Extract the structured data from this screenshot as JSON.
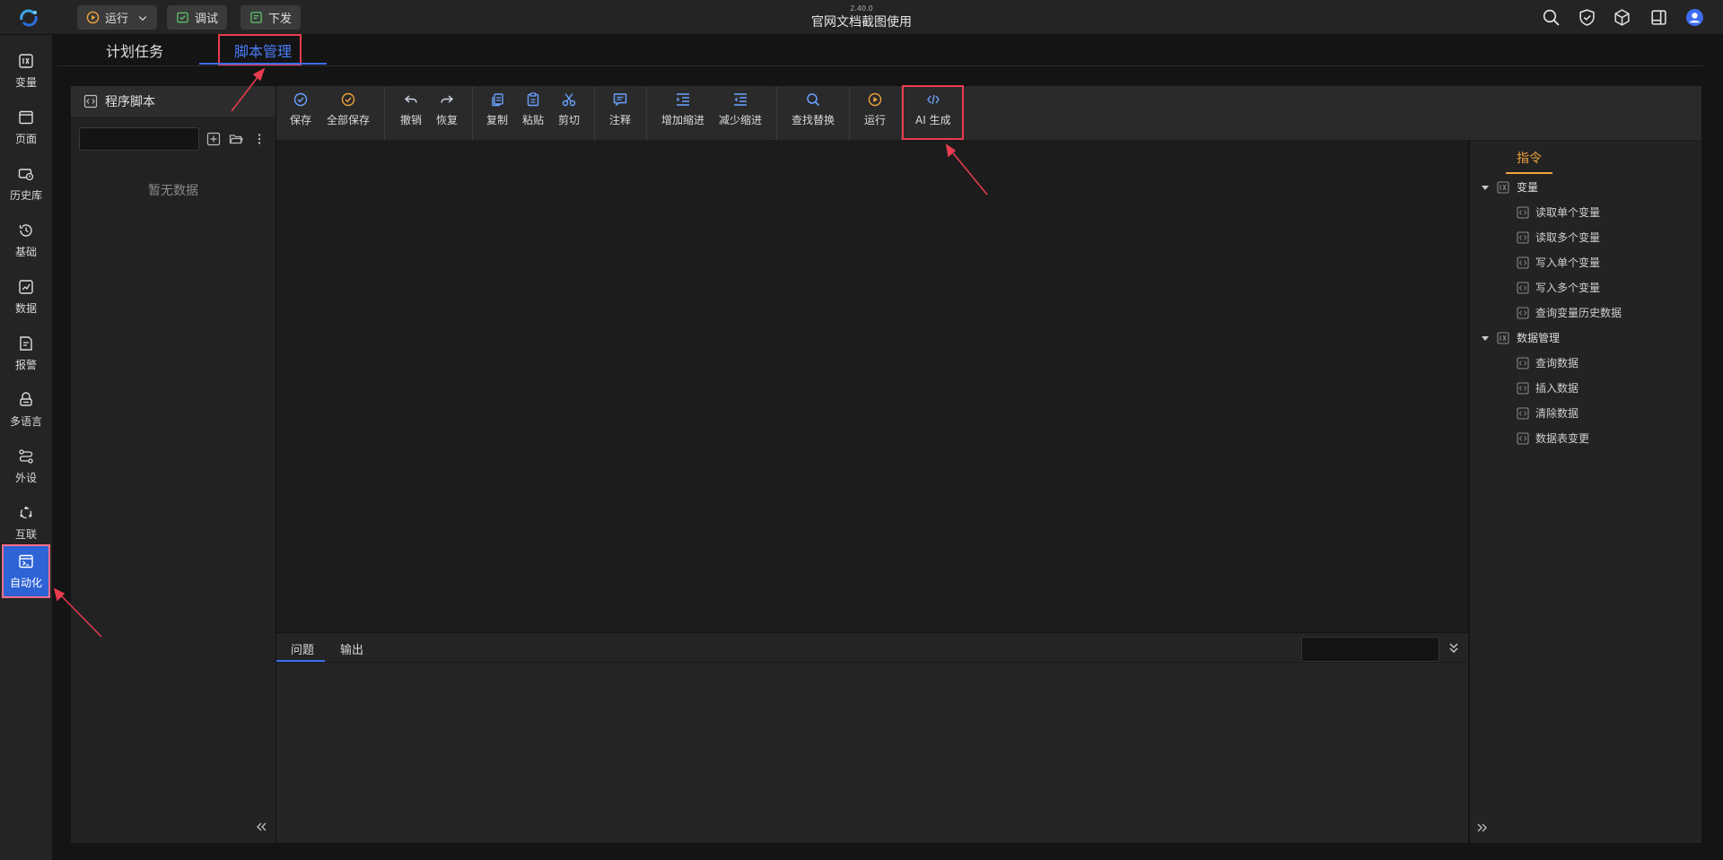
{
  "topbar": {
    "version": "2.40.0",
    "title": "官网文档截图使用",
    "run_label": "运行",
    "debug_label": "调试",
    "deploy_label": "下发",
    "icons": [
      "search-icon",
      "shield-check-icon",
      "package-icon",
      "layout-icon",
      "user-avatar-icon"
    ]
  },
  "sidebar": {
    "items": [
      {
        "label": "变量",
        "icon": "variable-icon"
      },
      {
        "label": "页面",
        "icon": "page-icon"
      },
      {
        "label": "历史库",
        "icon": "history-db-icon"
      },
      {
        "label": "基础",
        "icon": "clock-icon"
      },
      {
        "label": "数据",
        "icon": "data-chart-icon"
      },
      {
        "label": "报警",
        "icon": "alarm-doc-icon"
      },
      {
        "label": "多语言",
        "icon": "language-icon"
      },
      {
        "label": "外设",
        "icon": "peripheral-icon"
      },
      {
        "label": "互联",
        "icon": "interconnect-icon"
      },
      {
        "label": "自动化",
        "icon": "automation-icon",
        "active": true
      }
    ]
  },
  "tabs": {
    "plan": "计划任务",
    "script": "脚本管理"
  },
  "left_panel": {
    "header": "程序脚本",
    "search_value": "",
    "empty_text": "暂无数据"
  },
  "toolbar": {
    "save": "保存",
    "save_all": "全部保存",
    "undo": "撤销",
    "redo": "恢复",
    "copy": "复制",
    "paste": "粘贴",
    "cut": "剪切",
    "comment": "注释",
    "indent": "增加缩进",
    "outdent": "减少缩进",
    "find_replace": "查找替换",
    "run": "运行",
    "ai": "AI 生成"
  },
  "bottom": {
    "problems": "问题",
    "output": "输出",
    "search_value": ""
  },
  "right_panel": {
    "tab": "指令",
    "groups": [
      {
        "label": "变量",
        "items": [
          "读取单个变量",
          "读取多个变量",
          "写入单个变量",
          "写入多个变量",
          "查询变量历史数据"
        ]
      },
      {
        "label": "数据管理",
        "items": [
          "查询数据",
          "插入数据",
          "清除数据",
          "数据表变更"
        ]
      }
    ]
  },
  "colors": {
    "accent_blue": "#3d6df2",
    "annotation_red": "#ea3c4f",
    "orange": "#f0a23b"
  }
}
